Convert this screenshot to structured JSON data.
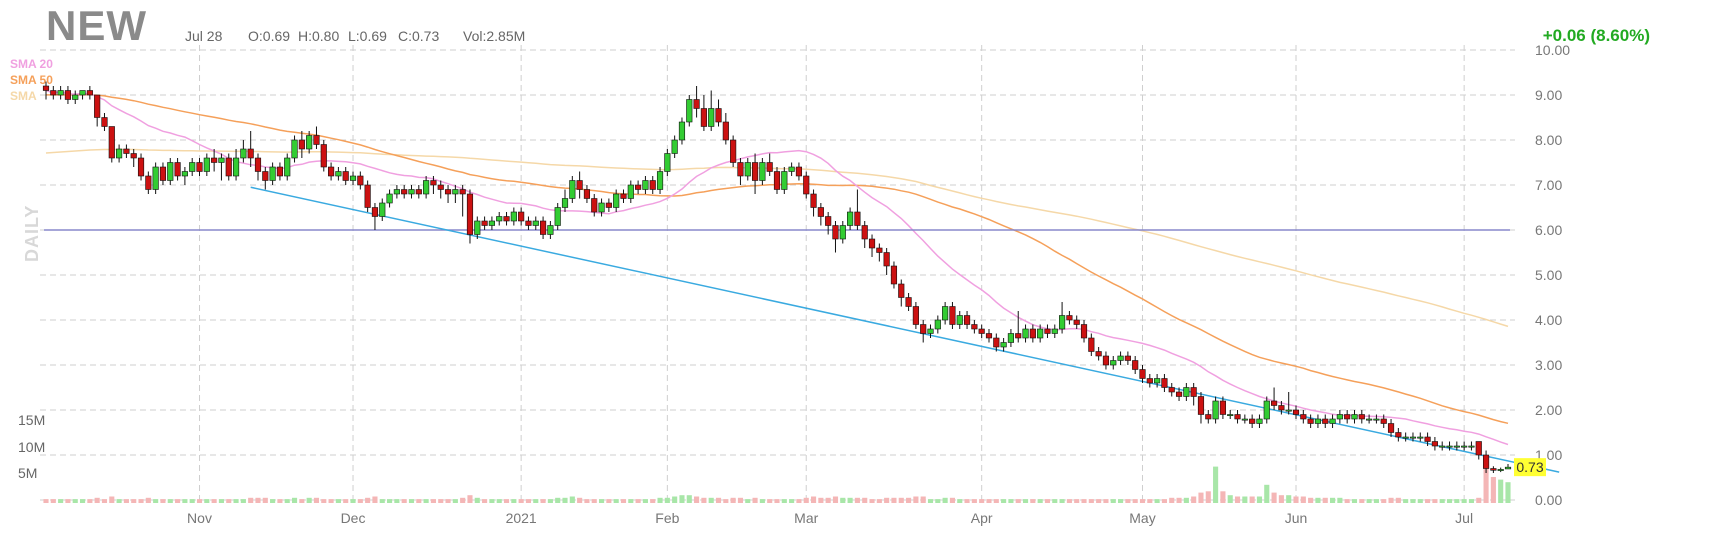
{
  "header": {
    "ticker": "NEW",
    "date": "Jul 28",
    "open": "O:0.69",
    "high": "H:0.80",
    "low": "L:0.69",
    "close": "C:0.73",
    "volume": "Vol:2.85M",
    "change": "+0.06 (8.60%)",
    "timeframe": "DAILY"
  },
  "legend": [
    {
      "label": "SMA 20",
      "color": "#f0a0e0"
    },
    {
      "label": "SMA 50",
      "color": "#f5a05a"
    },
    {
      "label": "SMA",
      "color": "#f5d8a8"
    }
  ],
  "colors": {
    "up": "#33cc33",
    "down": "#cc1111",
    "sma20": "#f0a0e0",
    "sma50": "#f5a05a",
    "sma200": "#f5d8a8",
    "trendline": "#3aaae0",
    "hline": "#8888cc",
    "last_price_bg": "#ffff33"
  },
  "chart_data": {
    "type": "candlestick",
    "ticker": "NEW",
    "price_ylim": [
      0,
      10
    ],
    "price_ticks": [
      "10.00",
      "9.00",
      "8.00",
      "7.00",
      "6.00",
      "5.00",
      "4.00",
      "3.00",
      "2.00",
      "1.00",
      "0.00"
    ],
    "volume_ticks": [
      "15M",
      "10M",
      "5M"
    ],
    "x_ticks": [
      "Nov",
      "Dec",
      "2021",
      "Feb",
      "Mar",
      "Apr",
      "May",
      "Jun",
      "Jul"
    ],
    "x_tick_index": [
      21,
      42,
      65,
      85,
      104,
      128,
      150,
      171,
      194
    ],
    "last_price": "0.73",
    "horizontal_line": 6.0,
    "trendline": {
      "from": {
        "i": 28,
        "y": 6.95
      },
      "to": {
        "i": 207,
        "y": 0.62
      }
    },
    "candles": [
      [
        9.2,
        9.1,
        9.3,
        8.9,
        0.3
      ],
      [
        9.1,
        9.0,
        9.2,
        8.9,
        0.3
      ],
      [
        9.0,
        9.1,
        9.2,
        8.9,
        0.3
      ],
      [
        9.1,
        8.9,
        9.2,
        8.8,
        0.3
      ],
      [
        8.9,
        9.0,
        9.1,
        8.8,
        0.3
      ],
      [
        9.0,
        9.1,
        9.1,
        8.9,
        0.3
      ],
      [
        9.1,
        9.0,
        9.2,
        8.9,
        0.3
      ],
      [
        9.0,
        8.5,
        9.0,
        8.3,
        0.4
      ],
      [
        8.5,
        8.3,
        8.6,
        8.2,
        0.3
      ],
      [
        8.3,
        7.6,
        8.3,
        7.5,
        0.5
      ],
      [
        7.6,
        7.8,
        7.9,
        7.5,
        0.3
      ],
      [
        7.8,
        7.7,
        7.9,
        7.6,
        0.3
      ],
      [
        7.7,
        7.6,
        7.8,
        7.4,
        0.3
      ],
      [
        7.6,
        7.2,
        7.7,
        7.1,
        0.3
      ],
      [
        7.2,
        6.9,
        7.3,
        6.8,
        0.4
      ],
      [
        6.9,
        7.4,
        7.5,
        6.8,
        0.3
      ],
      [
        7.4,
        7.1,
        7.5,
        7.0,
        0.3
      ],
      [
        7.1,
        7.5,
        7.6,
        7.0,
        0.3
      ],
      [
        7.5,
        7.2,
        7.6,
        7.1,
        0.3
      ],
      [
        7.2,
        7.3,
        7.4,
        7.0,
        0.3
      ],
      [
        7.3,
        7.5,
        7.6,
        7.2,
        0.3
      ],
      [
        7.5,
        7.3,
        7.6,
        7.2,
        0.3
      ],
      [
        7.3,
        7.6,
        7.7,
        7.2,
        0.3
      ],
      [
        7.6,
        7.5,
        7.8,
        7.3,
        0.3
      ],
      [
        7.5,
        7.6,
        7.7,
        7.1,
        0.3
      ],
      [
        7.6,
        7.2,
        7.7,
        7.1,
        0.3
      ],
      [
        7.2,
        7.6,
        7.8,
        7.1,
        0.3
      ],
      [
        7.6,
        7.8,
        8.0,
        7.5,
        0.3
      ],
      [
        7.8,
        7.6,
        8.2,
        7.4,
        0.4
      ],
      [
        7.6,
        7.3,
        7.7,
        7.1,
        0.4
      ],
      [
        7.3,
        7.1,
        7.4,
        6.9,
        0.4
      ],
      [
        7.1,
        7.4,
        7.5,
        7.0,
        0.3
      ],
      [
        7.4,
        7.2,
        7.5,
        7.1,
        0.3
      ],
      [
        7.2,
        7.6,
        7.7,
        7.1,
        0.3
      ],
      [
        7.6,
        8.0,
        8.1,
        7.5,
        0.4
      ],
      [
        8.0,
        7.8,
        8.2,
        7.6,
        0.3
      ],
      [
        7.8,
        8.1,
        8.2,
        7.7,
        0.4
      ],
      [
        8.1,
        7.9,
        8.3,
        7.8,
        0.4
      ],
      [
        7.9,
        7.4,
        8.0,
        7.3,
        0.3
      ],
      [
        7.4,
        7.2,
        7.5,
        7.1,
        0.3
      ],
      [
        7.2,
        7.3,
        7.4,
        7.1,
        0.3
      ],
      [
        7.3,
        7.1,
        7.4,
        7.0,
        0.3
      ],
      [
        7.1,
        7.2,
        7.3,
        7.0,
        0.3
      ],
      [
        7.2,
        7.0,
        7.3,
        6.9,
        0.3
      ],
      [
        7.0,
        6.5,
        7.1,
        6.4,
        0.4
      ],
      [
        6.5,
        6.3,
        6.6,
        6.0,
        0.5
      ],
      [
        6.3,
        6.6,
        6.7,
        6.2,
        0.3
      ],
      [
        6.6,
        6.8,
        6.9,
        6.5,
        0.3
      ],
      [
        6.8,
        6.9,
        7.0,
        6.7,
        0.3
      ],
      [
        6.9,
        6.8,
        7.0,
        6.7,
        0.3
      ],
      [
        6.8,
        6.9,
        7.0,
        6.7,
        0.3
      ],
      [
        6.9,
        6.8,
        7.0,
        6.7,
        0.3
      ],
      [
        6.8,
        7.1,
        7.2,
        6.7,
        0.3
      ],
      [
        7.1,
        7.0,
        7.2,
        6.8,
        0.3
      ],
      [
        7.0,
        6.9,
        7.1,
        6.7,
        0.3
      ],
      [
        6.9,
        6.8,
        7.0,
        6.6,
        0.3
      ],
      [
        6.8,
        6.9,
        7.0,
        6.6,
        0.3
      ],
      [
        6.9,
        6.8,
        7.0,
        6.3,
        0.4
      ],
      [
        6.8,
        5.9,
        6.9,
        5.7,
        0.6
      ],
      [
        5.9,
        6.2,
        6.3,
        5.8,
        0.4
      ],
      [
        6.2,
        6.1,
        6.3,
        6.0,
        0.3
      ],
      [
        6.1,
        6.2,
        6.3,
        6.0,
        0.3
      ],
      [
        6.2,
        6.3,
        6.4,
        6.1,
        0.3
      ],
      [
        6.3,
        6.2,
        6.4,
        6.1,
        0.3
      ],
      [
        6.2,
        6.4,
        6.5,
        6.1,
        0.3
      ],
      [
        6.4,
        6.2,
        6.5,
        6.1,
        0.3
      ],
      [
        6.2,
        6.1,
        6.3,
        6.0,
        0.3
      ],
      [
        6.1,
        6.2,
        6.3,
        6.0,
        0.3
      ],
      [
        6.2,
        5.9,
        6.3,
        5.8,
        0.3
      ],
      [
        5.9,
        6.1,
        6.2,
        5.8,
        0.3
      ],
      [
        6.1,
        6.5,
        6.6,
        6.0,
        0.4
      ],
      [
        6.5,
        6.7,
        6.9,
        6.4,
        0.4
      ],
      [
        6.7,
        7.1,
        7.2,
        6.6,
        0.5
      ],
      [
        7.1,
        6.9,
        7.3,
        6.7,
        0.4
      ],
      [
        6.9,
        6.7,
        7.0,
        6.6,
        0.3
      ],
      [
        6.7,
        6.4,
        6.8,
        6.3,
        0.3
      ],
      [
        6.4,
        6.6,
        6.7,
        6.3,
        0.3
      ],
      [
        6.6,
        6.5,
        6.7,
        6.4,
        0.3
      ],
      [
        6.5,
        6.8,
        6.9,
        6.4,
        0.3
      ],
      [
        6.8,
        6.7,
        6.9,
        6.6,
        0.3
      ],
      [
        6.7,
        7.0,
        7.1,
        6.6,
        0.3
      ],
      [
        7.0,
        6.9,
        7.1,
        6.8,
        0.3
      ],
      [
        6.9,
        7.1,
        7.2,
        6.8,
        0.3
      ],
      [
        7.1,
        6.9,
        7.2,
        6.8,
        0.3
      ],
      [
        6.9,
        7.3,
        7.4,
        6.8,
        0.4
      ],
      [
        7.3,
        7.7,
        7.8,
        7.2,
        0.4
      ],
      [
        7.7,
        8.0,
        8.1,
        7.6,
        0.5
      ],
      [
        8.0,
        8.4,
        8.5,
        7.9,
        0.6
      ],
      [
        8.4,
        8.9,
        9.0,
        8.3,
        0.6
      ],
      [
        8.9,
        8.7,
        9.2,
        8.5,
        0.5
      ],
      [
        8.7,
        8.3,
        9.0,
        8.2,
        0.4
      ],
      [
        8.3,
        8.7,
        9.1,
        8.2,
        0.4
      ],
      [
        8.7,
        8.4,
        8.9,
        8.3,
        0.4
      ],
      [
        8.4,
        8.0,
        8.6,
        7.9,
        0.3
      ],
      [
        8.0,
        7.5,
        8.1,
        7.4,
        0.4
      ],
      [
        7.5,
        7.2,
        7.6,
        7.0,
        0.4
      ],
      [
        7.2,
        7.5,
        7.6,
        7.1,
        0.3
      ],
      [
        7.5,
        7.1,
        7.7,
        6.8,
        0.4
      ],
      [
        7.1,
        7.5,
        7.6,
        7.0,
        0.3
      ],
      [
        7.5,
        7.3,
        7.7,
        7.2,
        0.3
      ],
      [
        7.3,
        6.9,
        7.4,
        6.8,
        0.3
      ],
      [
        6.9,
        7.3,
        7.4,
        6.8,
        0.3
      ],
      [
        7.3,
        7.4,
        7.5,
        7.2,
        0.3
      ],
      [
        7.4,
        7.2,
        7.5,
        7.1,
        0.3
      ],
      [
        7.2,
        6.8,
        7.3,
        6.7,
        0.4
      ],
      [
        6.8,
        6.5,
        6.9,
        6.3,
        0.5
      ],
      [
        6.5,
        6.3,
        6.6,
        6.1,
        0.4
      ],
      [
        6.3,
        6.1,
        6.4,
        5.9,
        0.4
      ],
      [
        6.1,
        5.8,
        6.2,
        5.5,
        0.5
      ],
      [
        5.8,
        6.1,
        6.2,
        5.7,
        0.4
      ],
      [
        6.1,
        6.4,
        6.5,
        6.0,
        0.4
      ],
      [
        6.4,
        6.1,
        6.9,
        6.0,
        0.4
      ],
      [
        6.1,
        5.8,
        6.2,
        5.6,
        0.4
      ],
      [
        5.8,
        5.6,
        5.9,
        5.4,
        0.3
      ],
      [
        5.6,
        5.5,
        5.7,
        5.3,
        0.3
      ],
      [
        5.5,
        5.2,
        5.6,
        5.0,
        0.4
      ],
      [
        5.2,
        4.8,
        5.3,
        4.7,
        0.4
      ],
      [
        4.8,
        4.5,
        4.9,
        4.3,
        0.4
      ],
      [
        4.5,
        4.3,
        4.6,
        4.2,
        0.4
      ],
      [
        4.3,
        3.9,
        4.4,
        3.8,
        0.5
      ],
      [
        3.9,
        3.7,
        4.0,
        3.5,
        0.5
      ],
      [
        3.7,
        3.8,
        3.9,
        3.6,
        0.3
      ],
      [
        3.8,
        4.0,
        4.1,
        3.7,
        0.3
      ],
      [
        4.0,
        4.3,
        4.4,
        3.9,
        0.4
      ],
      [
        4.3,
        3.9,
        4.4,
        3.8,
        0.4
      ],
      [
        3.9,
        4.1,
        4.2,
        3.8,
        0.3
      ],
      [
        4.1,
        3.9,
        4.2,
        3.8,
        0.3
      ],
      [
        3.9,
        3.8,
        4.0,
        3.7,
        0.3
      ],
      [
        3.8,
        3.7,
        3.9,
        3.6,
        0.3
      ],
      [
        3.7,
        3.6,
        3.8,
        3.5,
        0.3
      ],
      [
        3.6,
        3.4,
        3.7,
        3.3,
        0.3
      ],
      [
        3.4,
        3.5,
        3.6,
        3.3,
        0.3
      ],
      [
        3.5,
        3.7,
        3.8,
        3.4,
        0.3
      ],
      [
        3.7,
        3.6,
        4.2,
        3.5,
        0.3
      ],
      [
        3.6,
        3.8,
        3.9,
        3.5,
        0.3
      ],
      [
        3.8,
        3.6,
        3.9,
        3.5,
        0.3
      ],
      [
        3.6,
        3.8,
        3.9,
        3.5,
        0.3
      ],
      [
        3.8,
        3.7,
        3.9,
        3.6,
        0.3
      ],
      [
        3.7,
        3.8,
        3.9,
        3.6,
        0.3
      ],
      [
        3.8,
        4.1,
        4.4,
        3.7,
        0.3
      ],
      [
        4.1,
        4.0,
        4.2,
        3.9,
        0.3
      ],
      [
        4.0,
        3.9,
        4.1,
        3.8,
        0.3
      ],
      [
        3.9,
        3.6,
        4.0,
        3.5,
        0.3
      ],
      [
        3.6,
        3.3,
        3.7,
        3.2,
        0.3
      ],
      [
        3.3,
        3.2,
        3.4,
        3.1,
        0.3
      ],
      [
        3.2,
        3.0,
        3.3,
        2.9,
        0.3
      ],
      [
        3.0,
        3.1,
        3.2,
        2.9,
        0.3
      ],
      [
        3.1,
        3.2,
        3.3,
        3.0,
        0.3
      ],
      [
        3.2,
        3.1,
        3.3,
        3.0,
        0.3
      ],
      [
        3.1,
        2.9,
        3.2,
        2.8,
        0.3
      ],
      [
        2.9,
        2.7,
        3.0,
        2.6,
        0.3
      ],
      [
        2.7,
        2.6,
        2.8,
        2.5,
        0.3
      ],
      [
        2.6,
        2.7,
        2.8,
        2.5,
        0.3
      ],
      [
        2.7,
        2.5,
        2.8,
        2.4,
        0.3
      ],
      [
        2.5,
        2.4,
        2.6,
        2.3,
        0.4
      ],
      [
        2.4,
        2.3,
        2.5,
        2.2,
        0.4
      ],
      [
        2.3,
        2.5,
        2.6,
        2.2,
        0.4
      ],
      [
        2.5,
        2.3,
        2.6,
        2.1,
        0.5
      ],
      [
        2.3,
        1.9,
        2.4,
        1.7,
        0.8
      ],
      [
        1.9,
        1.8,
        2.0,
        1.7,
        0.9
      ],
      [
        1.8,
        2.2,
        2.3,
        1.7,
        2.8
      ],
      [
        2.2,
        1.9,
        2.3,
        1.8,
        0.9
      ],
      [
        1.9,
        1.9,
        2.0,
        1.8,
        0.6
      ],
      [
        1.9,
        1.8,
        2.0,
        1.7,
        0.5
      ],
      [
        1.8,
        1.8,
        1.9,
        1.7,
        0.5
      ],
      [
        1.8,
        1.7,
        1.9,
        1.6,
        0.5
      ],
      [
        1.7,
        1.8,
        1.9,
        1.6,
        0.5
      ],
      [
        1.8,
        2.2,
        2.3,
        1.7,
        1.4
      ],
      [
        2.2,
        2.1,
        2.5,
        2.0,
        0.8
      ],
      [
        2.1,
        2.0,
        2.2,
        1.9,
        0.6
      ],
      [
        2.0,
        2.0,
        2.4,
        1.9,
        0.6
      ],
      [
        2.0,
        1.9,
        2.1,
        1.8,
        0.5
      ],
      [
        1.9,
        1.8,
        2.0,
        1.7,
        0.5
      ],
      [
        1.8,
        1.7,
        1.9,
        1.6,
        0.4
      ],
      [
        1.7,
        1.8,
        1.9,
        1.6,
        0.4
      ],
      [
        1.8,
        1.7,
        1.9,
        1.6,
        0.4
      ],
      [
        1.7,
        1.8,
        1.9,
        1.6,
        0.4
      ],
      [
        1.8,
        1.9,
        2.0,
        1.7,
        0.4
      ],
      [
        1.9,
        1.8,
        2.0,
        1.7,
        0.3
      ],
      [
        1.8,
        1.9,
        2.0,
        1.7,
        0.3
      ],
      [
        1.9,
        1.8,
        2.0,
        1.7,
        0.3
      ],
      [
        1.8,
        1.8,
        1.9,
        1.7,
        0.3
      ],
      [
        1.8,
        1.8,
        1.9,
        1.7,
        0.3
      ],
      [
        1.8,
        1.7,
        1.9,
        1.6,
        0.3
      ],
      [
        1.7,
        1.5,
        1.8,
        1.4,
        0.4
      ],
      [
        1.5,
        1.4,
        1.6,
        1.3,
        0.4
      ],
      [
        1.4,
        1.4,
        1.5,
        1.3,
        0.3
      ],
      [
        1.4,
        1.4,
        1.5,
        1.3,
        0.3
      ],
      [
        1.4,
        1.4,
        1.5,
        1.3,
        0.3
      ],
      [
        1.4,
        1.3,
        1.5,
        1.2,
        0.3
      ],
      [
        1.3,
        1.2,
        1.4,
        1.1,
        0.3
      ],
      [
        1.2,
        1.2,
        1.3,
        1.1,
        0.3
      ],
      [
        1.2,
        1.2,
        1.3,
        1.1,
        0.3
      ],
      [
        1.2,
        1.2,
        1.3,
        1.1,
        0.3
      ],
      [
        1.2,
        1.2,
        1.3,
        1.1,
        0.3
      ],
      [
        1.2,
        1.2,
        1.3,
        1.1,
        0.3
      ],
      [
        1.3,
        1.0,
        1.3,
        0.9,
        0.4
      ],
      [
        1.0,
        0.7,
        1.1,
        0.6,
        3.1
      ],
      [
        0.7,
        0.66,
        0.75,
        0.6,
        2.0
      ],
      [
        0.66,
        0.68,
        0.72,
        0.62,
        1.8
      ],
      [
        0.69,
        0.73,
        0.8,
        0.69,
        1.6
      ]
    ]
  }
}
